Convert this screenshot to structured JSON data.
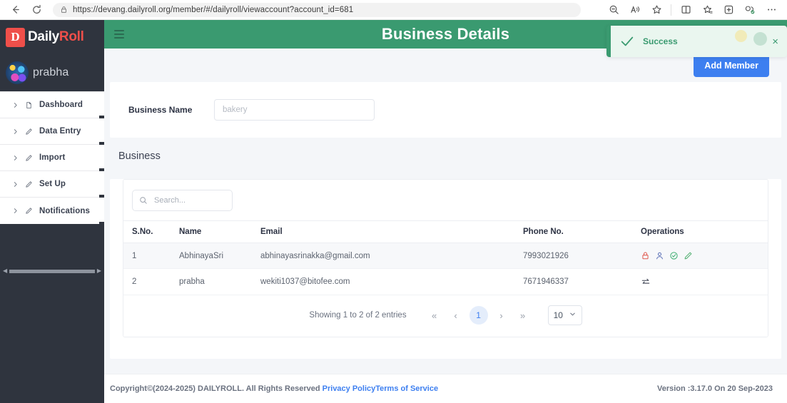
{
  "browser": {
    "back_label": "back",
    "refresh_label": "refresh",
    "url": "https://devang.dailyroll.org/member/#/dailyroll/viewaccount?account_id=681",
    "lock_icon": "lock-icon",
    "toolbar_icons": [
      "zoom-out-icon",
      "read-aloud-icon",
      "favorite-star-icon",
      "split-screen-icon",
      "collections-icon",
      "add-to-favorites-icon",
      "browser-essentials-icon",
      "settings-more-icon"
    ]
  },
  "sidebar": {
    "brand": {
      "mark": "D",
      "name_part1": "Daily",
      "name_part2": "Roll"
    },
    "profile": {
      "name": "prabha",
      "avatar": "user-avatar"
    },
    "items": [
      {
        "label": "Dashboard",
        "icon": "file-icon"
      },
      {
        "label": "Data Entry",
        "icon": "pencil-icon"
      },
      {
        "label": "Import",
        "icon": "pencil-icon"
      },
      {
        "label": "Set Up",
        "icon": "pencil-icon"
      },
      {
        "label": "Notifications",
        "icon": "pencil-icon"
      }
    ],
    "scrollbar": {
      "left_arrow": "◀",
      "right_arrow": "▶"
    }
  },
  "header": {
    "menu_icon": "hamburger-icon",
    "title": "Business Details",
    "accent_color": "#3a9a70"
  },
  "toast": {
    "icon": "check-icon",
    "message": "Success",
    "close_label": "×",
    "color": "#3a9a70"
  },
  "toolbar": {
    "add_member_label": "Add Member",
    "accent_color": "#3d7ff0"
  },
  "form": {
    "business_name_label": "Business Name",
    "business_name_value": "",
    "business_name_placeholder": "bakery"
  },
  "section": {
    "title": "Business"
  },
  "search": {
    "icon": "search-icon",
    "value": "",
    "placeholder": "Search..."
  },
  "table": {
    "columns": [
      "S.No.",
      "Name",
      "Email",
      "Phone No.",
      "Operations"
    ],
    "rows": [
      {
        "sno": "1",
        "name": "AbhinayaSri",
        "email": "abhinayasrinakka@gmail.com",
        "phone": "7993021926",
        "operations": [
          "lock-icon",
          "person-icon",
          "check-circle-icon",
          "pencil-icon"
        ]
      },
      {
        "sno": "2",
        "name": "prabha",
        "email": "wekiti1037@bitofee.com",
        "phone": "7671946337",
        "operations": [
          "transfer-icon"
        ]
      }
    ]
  },
  "pagination": {
    "info": "Showing 1 to 2 of 2 entries",
    "first_label": "«",
    "prev_label": "‹",
    "current_page": "1",
    "next_label": "›",
    "last_label": "»",
    "per_page": "10"
  },
  "footer": {
    "copyright": "Copyright©(2024-2025) DAILYROLL. All Rights Reserved ",
    "privacy_link": "Privacy Policy",
    "terms_link": "Terms of Service",
    "version": "Version :3.17.0 On 20 Sep-2023"
  }
}
